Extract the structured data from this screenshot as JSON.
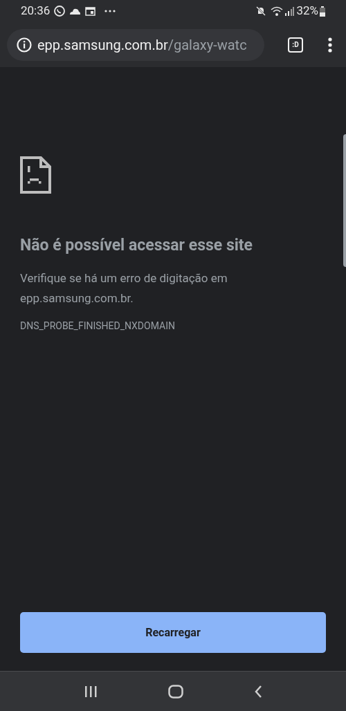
{
  "status_bar": {
    "time": "20:36",
    "battery": "32%"
  },
  "address_bar": {
    "domain": "epp.samsung.com.br",
    "path": "/galaxy-watc",
    "tab_button": ":D"
  },
  "error_page": {
    "title": "Não é possível acessar esse site",
    "message": "Verifique se há um erro de digitação em epp.samsung.com.br.",
    "code": "DNS_PROBE_FINISHED_NXDOMAIN",
    "button": "Recarregar"
  }
}
